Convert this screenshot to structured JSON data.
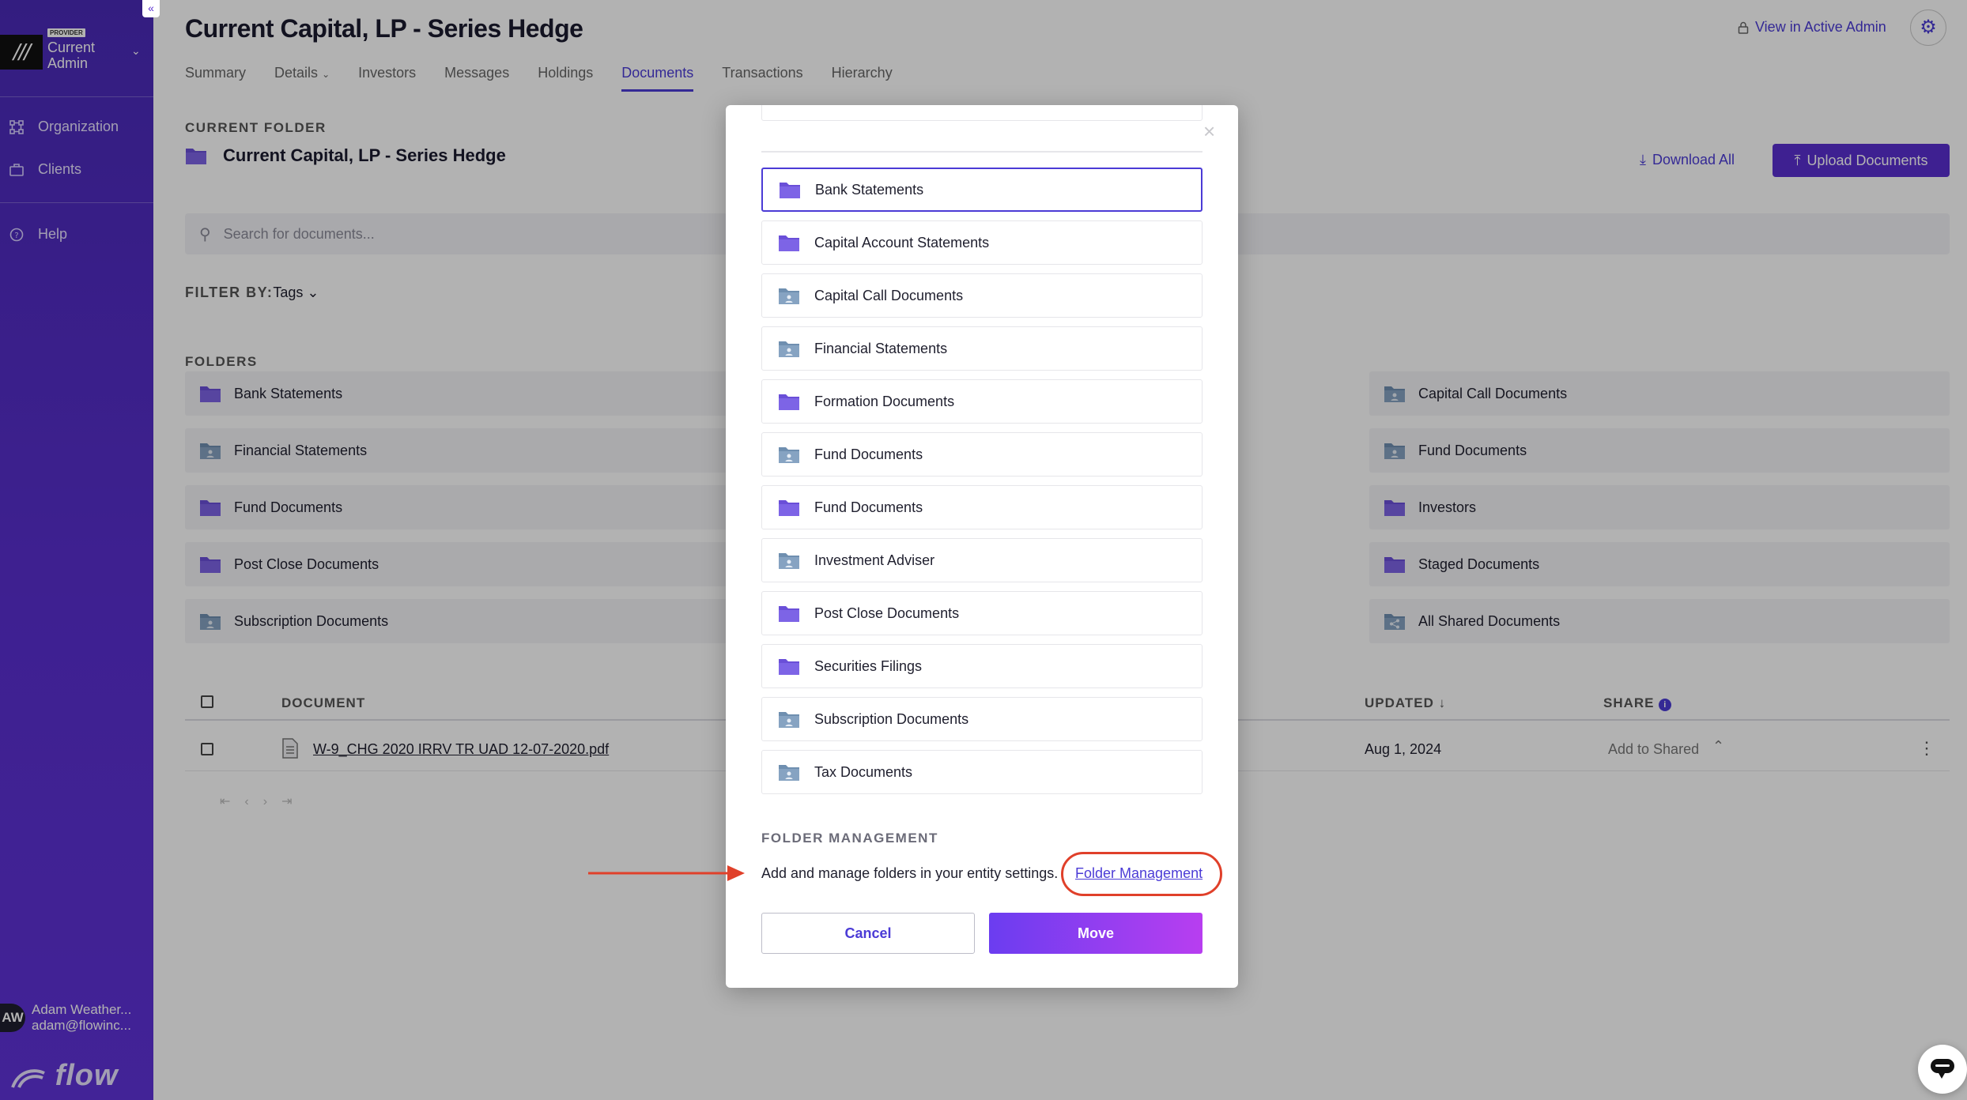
{
  "sidebar": {
    "collapse_glyph": "«",
    "logo_glyph": "///",
    "provider_badge": "PROVIDER",
    "org_name": "Current\nAdmin",
    "org_line1": "Current",
    "org_line2": "Admin",
    "nav": [
      {
        "label": "Organization",
        "icon": "org-icon"
      },
      {
        "label": "Clients",
        "icon": "briefcase-icon"
      },
      {
        "label": "Help",
        "icon": "help-icon"
      }
    ],
    "user": {
      "initials": "AW",
      "name": "Adam Weather...",
      "email": "adam@flowinc..."
    },
    "footer_logo": "flow"
  },
  "header": {
    "title": "Current Capital, LP - Series Hedge",
    "view_admin": "View in Active Admin",
    "tabs": [
      "Summary",
      "Details",
      "Investors",
      "Messages",
      "Holdings",
      "Documents",
      "Transactions",
      "Hierarchy"
    ],
    "active_tab": "Documents"
  },
  "current_folder": {
    "label": "CURRENT FOLDER",
    "name": "Current Capital, LP - Series Hedge",
    "download_all": "Download All",
    "upload": "Upload Documents"
  },
  "search": {
    "placeholder": "Search for documents..."
  },
  "filter": {
    "label": "FILTER BY:",
    "value": "Tags"
  },
  "folders": {
    "label": "FOLDERS",
    "left_col": [
      "Bank Statements",
      "Financial Statements",
      "Fund Documents",
      "Post Close Documents",
      "Subscription Documents"
    ],
    "right_col": [
      "Capital Call Documents",
      "Fund Documents",
      "Investors",
      "Staged Documents",
      "All Shared Documents"
    ]
  },
  "table": {
    "headers": {
      "document": "DOCUMENT",
      "updated": "UPDATED",
      "share": "SHARE"
    },
    "rows": [
      {
        "name": "W-9_CHG 2020 IRRV TR UAD 12-07-2020.pdf",
        "updated": "Aug 1, 2024",
        "share": "Add to Shared"
      }
    ]
  },
  "modal": {
    "folders": [
      {
        "name": "Bank Statements",
        "kind": "folder",
        "selected": true
      },
      {
        "name": "Capital Account Statements",
        "kind": "folder"
      },
      {
        "name": "Capital Call Documents",
        "kind": "shared"
      },
      {
        "name": "Financial Statements",
        "kind": "shared"
      },
      {
        "name": "Formation Documents",
        "kind": "folder"
      },
      {
        "name": "Fund Documents",
        "kind": "shared"
      },
      {
        "name": "Fund Documents",
        "kind": "folder"
      },
      {
        "name": "Investment Adviser",
        "kind": "shared"
      },
      {
        "name": "Post Close Documents",
        "kind": "folder"
      },
      {
        "name": "Securities Filings",
        "kind": "folder"
      },
      {
        "name": "Subscription Documents",
        "kind": "shared"
      },
      {
        "name": "Tax Documents",
        "kind": "shared"
      }
    ],
    "folder_mgmt_label": "FOLDER MANAGEMENT",
    "folder_mgmt_text": "Add and manage folders in your entity settings.",
    "folder_mgmt_link": "Folder Management",
    "cancel": "Cancel",
    "move": "Move"
  },
  "colors": {
    "brand_purple": "#5a2fd0",
    "accent": "#4b3bd6",
    "folder_purple": "#6a4fd8",
    "folder_shared": "#6f8fb0",
    "annotation_red": "#e0402a"
  }
}
